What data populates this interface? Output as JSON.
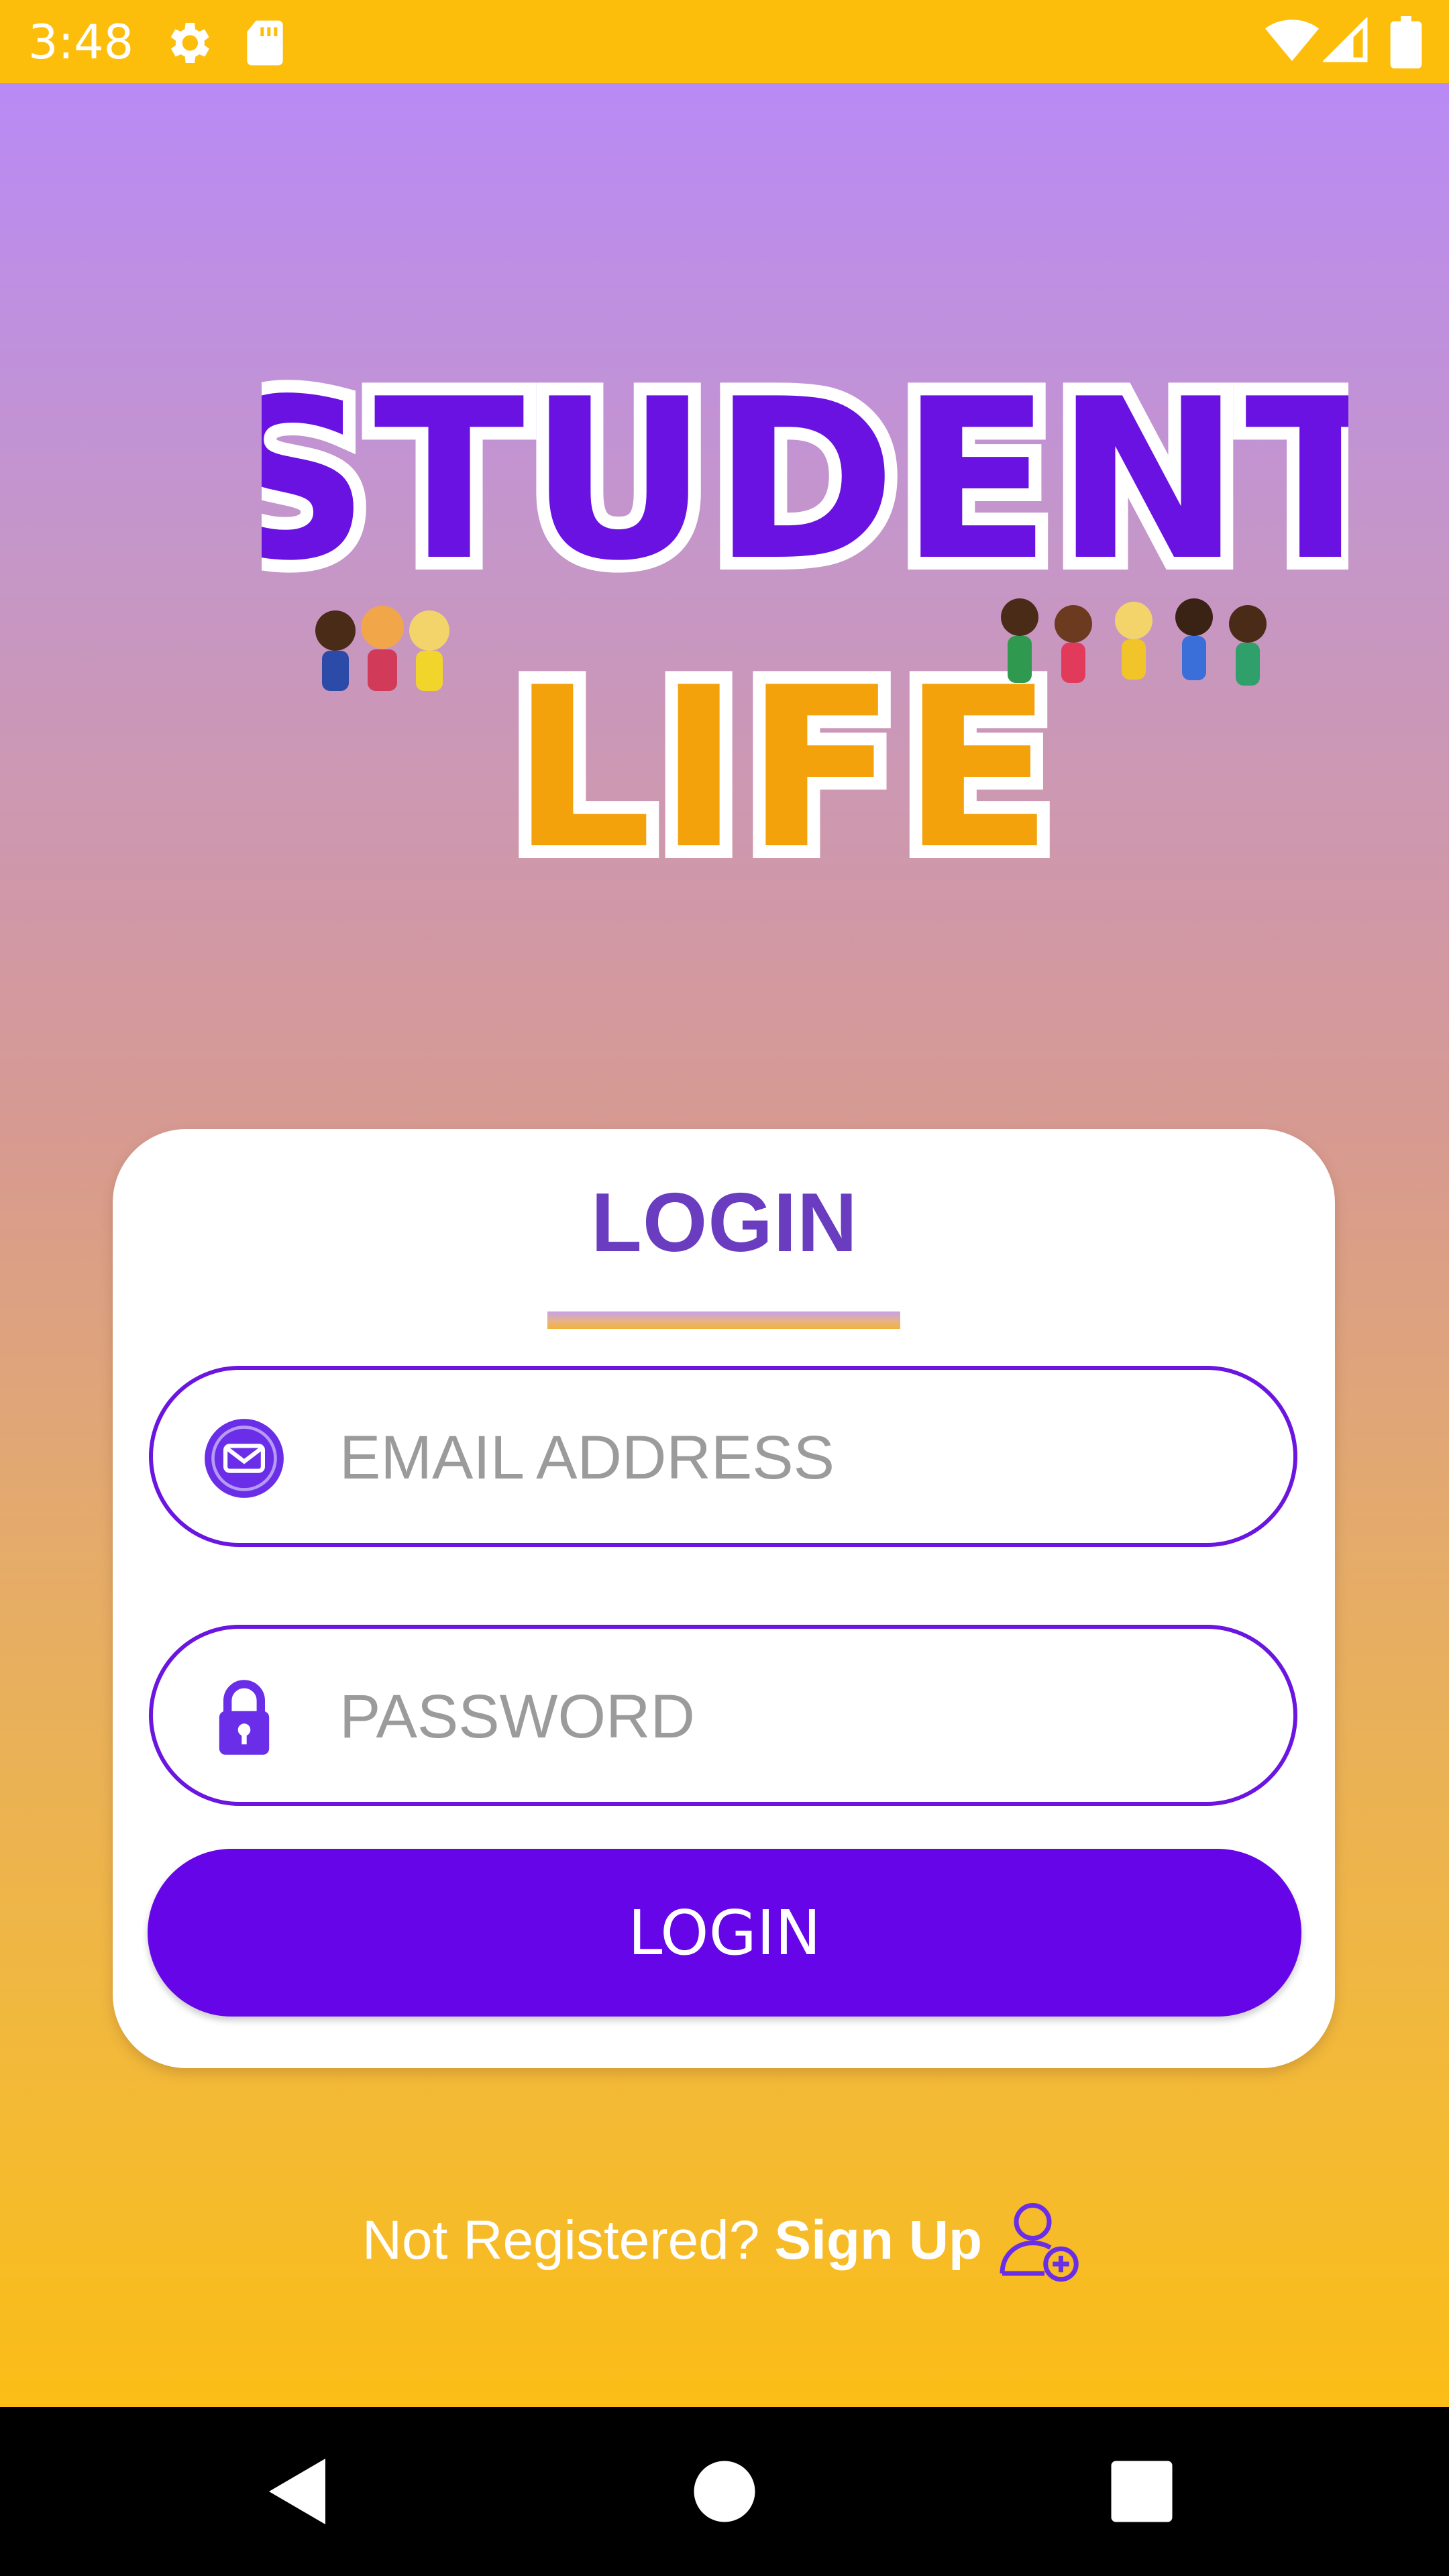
{
  "status_bar": {
    "time": "3:48",
    "icons": [
      "gear-icon",
      "sd-card-icon",
      "wifi-icon",
      "signal-icon",
      "battery-icon"
    ]
  },
  "logo": {
    "line1": "STUDENT",
    "line2": "LIFE"
  },
  "login_card": {
    "title": "LOGIN",
    "email": {
      "placeholder": "EMAIL ADDRESS",
      "value": "",
      "icon": "mail-icon"
    },
    "password": {
      "placeholder": "PASSWORD",
      "value": "",
      "icon": "lock-icon"
    },
    "button_label": "LOGIN"
  },
  "signup": {
    "prompt": "Not Registered?",
    "link": "Sign Up",
    "icon": "add-user-icon"
  },
  "nav_bar": {
    "buttons": [
      "back-icon",
      "home-icon",
      "recents-icon"
    ]
  },
  "colors": {
    "status_bar": "#fdbe0b",
    "accent": "#6605e8",
    "title": "#6a3cc0",
    "gradient_top": "#b98af5",
    "gradient_bottom": "#fbbd16"
  }
}
